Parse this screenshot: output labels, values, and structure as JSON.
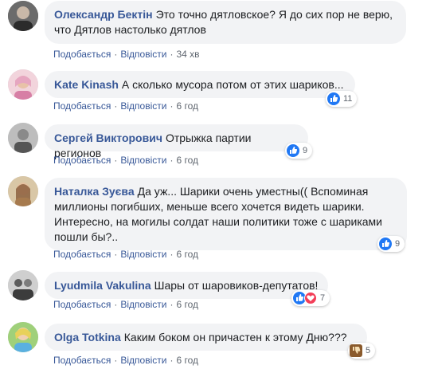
{
  "labels": {
    "like": "Подобається",
    "reply": "Відповісти",
    "dot": "·"
  },
  "comments": [
    {
      "author": "Олександр Бектін",
      "text": "Это точно дятловское? Я до сих пор не верю, что Дятлов настолько дятлов",
      "time": "34 хв",
      "reaction_count": ""
    },
    {
      "author": "Kate Kinash",
      "text": "А сколько мусора потом от этих шариков...",
      "time": "6 год",
      "reaction_count": "11"
    },
    {
      "author": "Сергей Викторович",
      "text": "Отрыжка партии регионов",
      "time": "6 год",
      "reaction_count": "9"
    },
    {
      "author": "Наталка Зуєва",
      "text": "Да уж... Шарики очень уместны(( Вспоминая миллионы погибших, меньше всего хочется видеть шарики. Интересно, на могилы солдат наши политики тоже с шариками пошли бы?..",
      "time": "6 год",
      "reaction_count": "9"
    },
    {
      "author": "Lyudmila Vakulina",
      "text": "Шары от шаровиков-депутатов!",
      "time": "6 год",
      "reaction_count": "7"
    },
    {
      "author": "Olga Totkina",
      "text": "Каким боком он причастен к этому Дню???",
      "time": "6 год",
      "reaction_count": "5"
    }
  ],
  "colors": {
    "author": "#385898",
    "bubble": "#f2f3f5",
    "like_reaction": "#2078f4",
    "love_reaction": "#f33e58"
  }
}
